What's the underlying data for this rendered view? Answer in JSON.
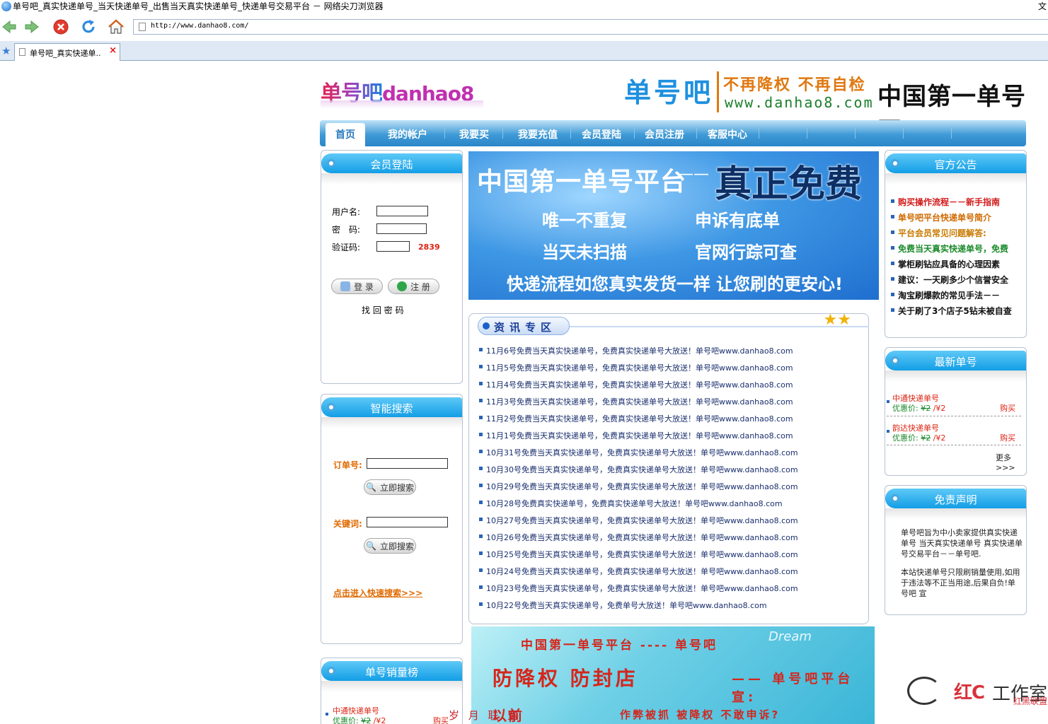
{
  "browser": {
    "window_title": "单号吧_真实快递单号_当天快递单号_出售当天真实快递单号_快递单号交易平台  －  网络尖刀浏览器",
    "window_title_right": "文",
    "address_url": "http://www.danhao8.com/",
    "tab_label": "单号吧_真实快递单..",
    "tab_close": "×",
    "fav_icon": "★"
  },
  "header": {
    "logo_cn": "单号吧",
    "logo_en": "danhao8",
    "brand": "单号吧",
    "slogan": "不再降权 不再自检",
    "url": "www.danhao8.com",
    "motto": "中国第一单号网"
  },
  "nav": {
    "items": [
      "首页",
      "我的帐户",
      "我要买",
      "我要充值",
      "会员登陆",
      "会员注册",
      "客服中心"
    ]
  },
  "login": {
    "title": "会员登陆",
    "username_label": "用户名:",
    "password_label": "密　码:",
    "captcha_label": "验证码:",
    "captcha_value": "2839",
    "login_button": "登 录",
    "register_button": "注 册",
    "forgot_link": "找 回 密 码"
  },
  "search": {
    "title": "智能搜索",
    "order_label": "订单号:",
    "keyword_label": "关键词:",
    "search_button": "立即搜索",
    "quick_link": "点击进入快速搜索>>>"
  },
  "sales_rank": {
    "title": "单号销量榜",
    "item_name": "中通快递单号",
    "price_label": "优惠价:",
    "old_price": "¥2",
    "new_price": "/¥2",
    "buy": "购买"
  },
  "hero": {
    "title": "中国第一单号平台",
    "dash": "——",
    "free": "真正免费",
    "line1": "唯一不重复",
    "line2": "申诉有底单",
    "line3": "当天未扫描",
    "line4": "官网行踪可查",
    "line5": "快递流程如您真实发货一样",
    "line6": "让您刷的更安心!"
  },
  "news": {
    "title": "资讯专区",
    "items": [
      "11月6号免费当天真实快递单号，免费真实快递单号大放送！单号吧www.danhao8.com",
      "11月5号免费当天真实快递单号，免费真实快递单号大放送！单号吧www.danhao8.com",
      "11月4号免费当天真实快递单号，免费真实快递单号大放送！单号吧www.danhao8.com",
      "11月3号免费当天真实快递单号，免费真实快递单号大放送！单号吧www.danhao8.com",
      "11月2号免费当天真实快递单号，免费真实快递单号大放送！单号吧www.danhao8.com",
      "11月1号免费当天真实快递单号，免费真实快递单号大放送！单号吧www.danhao8.com",
      "10月31号免费当天真实快递单号，免费真实快递单号大放送！单号吧www.danhao8.com",
      "10月30号免费当天真实快递单号，免费真实快递单号大放送！单号吧www.danhao8.com",
      "10月29号免费当天真实快递单号，免费真实快递单号大放送！单号吧www.danhao8.com",
      "10月28号免费真实快递单号，免费真实快递单号大放送！单号吧www.danhao8.com",
      "10月27号免费当天真实快递单号，免费真实快递单号大放送！单号吧www.danhao8.com",
      "10月26号免费当天真实快递单号，免费真实快递单号大放送！单号吧www.danhao8.com",
      "10月25号免费当天真实快递单号，免费真实快递单号大放送！单号吧www.danhao8.com",
      "10月24号免费当天真实快递单号，免费真实快递单号大放送！单号吧www.danhao8.com",
      "10月23号免费当天真实快递单号，免费真实快递单号大放送！单号吧www.danhao8.com",
      "10月22号免费当天真实快递单号，免费单号大放送！单号吧www.danhao8.com"
    ]
  },
  "bottom_ad": {
    "line1": "中国第一单号平台 ---- 单号吧",
    "line2": "防降权 防封店",
    "line3": "—— 单号吧平台 宣:",
    "line4": "以前",
    "line5": "作弊被抓 被降权 不敢申诉?",
    "brand": "Dream"
  },
  "notice": {
    "title": "官方公告",
    "items": [
      {
        "text": "购买操作流程－－新手指南",
        "color": "#d21a1a"
      },
      {
        "text": "单号吧平台快递单号简介",
        "color": "#d06a00"
      },
      {
        "text": "平台会员常见问题解答:",
        "color": "#c87a00"
      },
      {
        "text": "免费当天真实快递单号，免费",
        "color": "#1a8a2a"
      },
      {
        "text": "掌柜刷钻应具备的心理因素",
        "color": "#111111"
      },
      {
        "text": "建议：一天刷多少个信誉安全",
        "color": "#111111"
      },
      {
        "text": "淘宝刷爆款的常见手法－－",
        "color": "#111111"
      },
      {
        "text": "关于刷了3个店子5钻未被自查",
        "color": "#111111"
      }
    ]
  },
  "latest": {
    "title": "最新单号",
    "items": [
      {
        "name": "中通快递单号",
        "price_label": "优惠价:",
        "old_price": "¥2",
        "new_price": "/¥2",
        "buy": "购买"
      },
      {
        "name": "韵达快递单号",
        "price_label": "优惠价:",
        "old_price": "¥2",
        "new_price": "/¥2",
        "buy": "购买"
      }
    ],
    "more": "更多>>>"
  },
  "disclaimer": {
    "title": "免责声明",
    "para1": "单号吧旨为中小卖家提供真实快递单号 当天真实快递单号 真实快递单号交易平台－－单号吧.",
    "para2": "本站快递单号只限刷销量使用,如用于违法等不正当用途,后果自负!单号吧 宣"
  },
  "watermark": {
    "mid": "红C",
    "studio": "工作室",
    "union": "红黑联盟",
    "bottom": "岁 月 联 盟"
  },
  "colors": {
    "nav_blue": "#3f9ad6",
    "box_head": "#139ee6",
    "accent_red": "#d21a1a",
    "accent_orange": "#e06a00"
  }
}
